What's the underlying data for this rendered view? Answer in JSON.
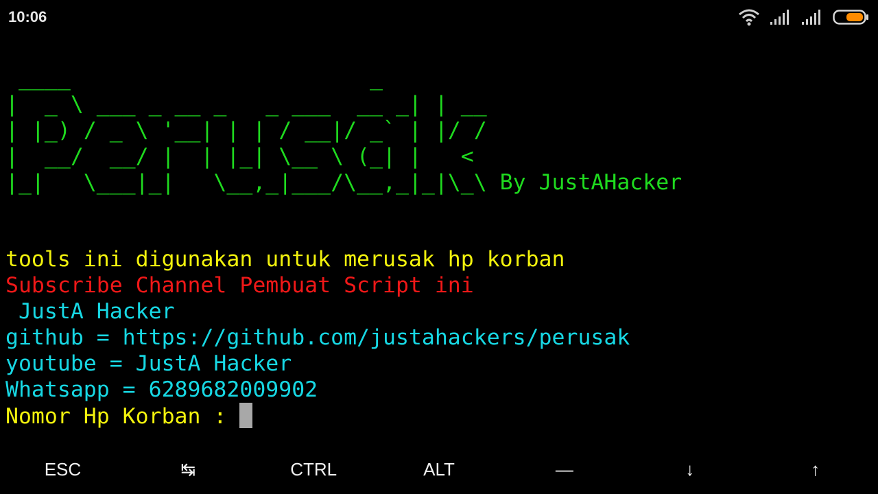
{
  "status_bar": {
    "time": "10:06",
    "icons": [
      "wifi-icon",
      "signal-icon",
      "signal-icon",
      "battery-icon"
    ],
    "battery_color": "#ff8c00"
  },
  "terminal": {
    "banner_color": "#1fdb1f",
    "banner_lines": [
      " ____                       _",
      "|  _ \\ ___ _ __ _   _ ___  __ _| | __",
      "| |_) / _ \\ '__| | | / __|/ _` | |/ /",
      "|  __/  __/ |  | |_| \\__ \\ (_| |   <",
      "|_|   \\___|_|   \\__,_|___/\\__,_|_|\\_\\ By JustAHacker"
    ],
    "lines": [
      {
        "text": "tools ini digunakan untuk merusak hp korban",
        "color": "yellow"
      },
      {
        "text": "Subscribe Channel Pembuat Script ini",
        "color": "red"
      },
      {
        "text": " JustA Hacker",
        "color": "cyan"
      },
      {
        "text": "github = https://github.com/justahackers/perusak",
        "color": "cyan"
      },
      {
        "text": "youtube = JustA Hacker",
        "color": "cyan"
      },
      {
        "text": "Whatsapp = 6289682009902",
        "color": "cyan"
      }
    ],
    "prompt": "Nomor Hp Korban : ",
    "input_value": ""
  },
  "extra_keys": [
    "ESC",
    "↹",
    "CTRL",
    "ALT",
    "—",
    "↓",
    "↑"
  ]
}
